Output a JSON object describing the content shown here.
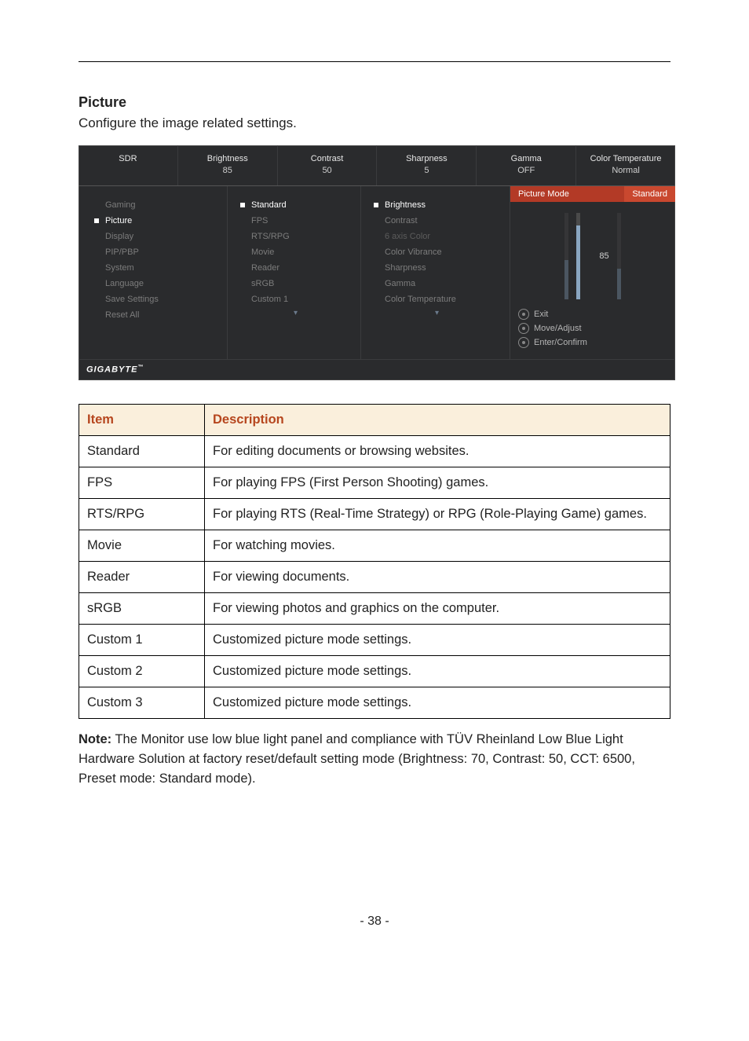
{
  "section": {
    "title": "Picture",
    "subtitle": "Configure the image related settings."
  },
  "osd": {
    "topbar": [
      {
        "label": "SDR",
        "value": ""
      },
      {
        "label": "Brightness",
        "value": "85"
      },
      {
        "label": "Contrast",
        "value": "50"
      },
      {
        "label": "Sharpness",
        "value": "5"
      },
      {
        "label": "Gamma",
        "value": "OFF"
      },
      {
        "label": "Color Temperature",
        "value": "Normal"
      }
    ],
    "mainMenu": [
      "Gaming",
      "Picture",
      "Display",
      "PIP/PBP",
      "System",
      "Language",
      "Save Settings",
      "Reset All"
    ],
    "mainActive": "Picture",
    "modes": [
      "Standard",
      "FPS",
      "RTS/RPG",
      "Movie",
      "Reader",
      "sRGB",
      "Custom 1"
    ],
    "modeActive": "Standard",
    "settings": [
      "Brightness",
      "Contrast",
      "6 axis Color",
      "Color Vibrance",
      "Sharpness",
      "Gamma",
      "Color Temperature"
    ],
    "settingActive": "Brightness",
    "settingDisabled": "6 axis Color",
    "pictureMode": {
      "label": "Picture Mode",
      "value": "Standard"
    },
    "sliderValue": "85",
    "sliderPct": 85,
    "hints": [
      "Exit",
      "Move/Adjust",
      "Enter/Confirm"
    ],
    "brand": "GIGABYTE"
  },
  "table": {
    "headers": [
      "Item",
      "Description"
    ],
    "rows": [
      [
        "Standard",
        "For editing documents or browsing websites."
      ],
      [
        "FPS",
        "For playing FPS (First Person Shooting) games."
      ],
      [
        "RTS/RPG",
        "For playing RTS (Real-Time Strategy) or RPG (Role-Playing Game) games."
      ],
      [
        "Movie",
        "For watching movies."
      ],
      [
        "Reader",
        "For viewing documents."
      ],
      [
        "sRGB",
        "For viewing photos and graphics on the computer."
      ],
      [
        "Custom 1",
        "Customized picture mode settings."
      ],
      [
        "Custom 2",
        "Customized picture mode settings."
      ],
      [
        "Custom 3",
        "Customized picture mode settings."
      ]
    ]
  },
  "note": {
    "label": "Note:",
    "text": " The Monitor use low blue light panel and compliance with TÜV Rheinland Low Blue Light Hardware Solution at factory reset/default setting mode (Brightness: 70, Contrast: 50, CCT: 6500, Preset mode: Standard mode)."
  },
  "pageNumber": "- 38 -"
}
